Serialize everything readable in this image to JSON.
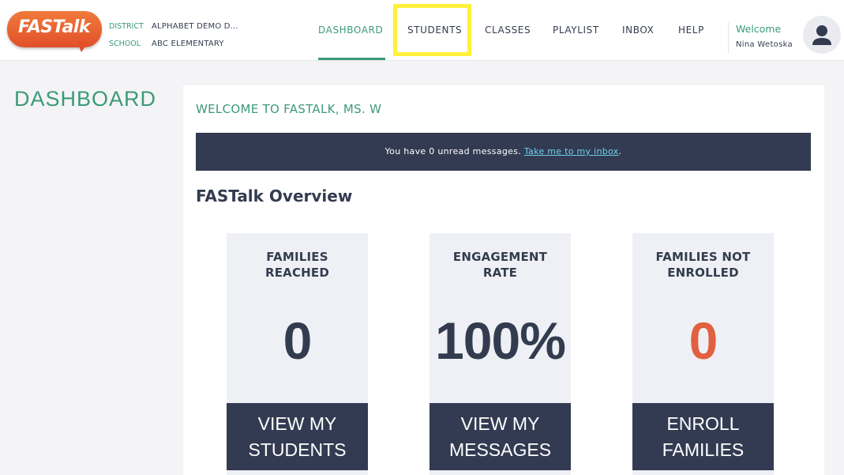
{
  "brand": {
    "logo_text": "FASTalk",
    "logo_color": "#e1502a"
  },
  "school_info": {
    "district_label": "DISTRICT",
    "district_value": "ALPHABET DEMO D...",
    "school_label": "SCHOOL",
    "school_value": "ABC ELEMENTARY"
  },
  "nav": {
    "items": [
      {
        "label": "DASHBOARD",
        "active": true
      },
      {
        "label": "STUDENTS",
        "active": false
      },
      {
        "label": "CLASSES",
        "active": false
      },
      {
        "label": "PLAYLIST",
        "active": false
      },
      {
        "label": "INBOX",
        "active": false
      },
      {
        "label": "HELP",
        "active": false
      }
    ]
  },
  "user": {
    "welcome_label": "Welcome",
    "name": "Nina Wetoska",
    "avatar_icon": "user-icon"
  },
  "page": {
    "title": "DASHBOARD"
  },
  "card": {
    "welcome_heading": "WELCOME TO FASTALK, MS. W",
    "banner_text": "You have 0 unread messages.",
    "banner_link": "Take me to my inbox",
    "banner_suffix": ".",
    "overview_title": "FASTalk Overview"
  },
  "stats": [
    {
      "label_line1": "FAMILIES",
      "label_line2": "REACHED",
      "value": "0",
      "button_line1": "VIEW MY",
      "button_line2": "STUDENTS"
    },
    {
      "label_line1": "ENGAGEMENT",
      "label_line2": "RATE",
      "value": "100%",
      "button_line1": "VIEW MY",
      "button_line2": "MESSAGES"
    },
    {
      "label_line1": "FAMILIES NOT",
      "label_line2": "ENROLLED",
      "value": "0",
      "button_line1": "ENROLL",
      "button_line2": "FAMILIES"
    }
  ],
  "colors": {
    "accent": "#3b9a79",
    "navy": "#323b52",
    "warning": "#e06040",
    "link": "#6fd0ee",
    "highlight": "#fff13a"
  }
}
